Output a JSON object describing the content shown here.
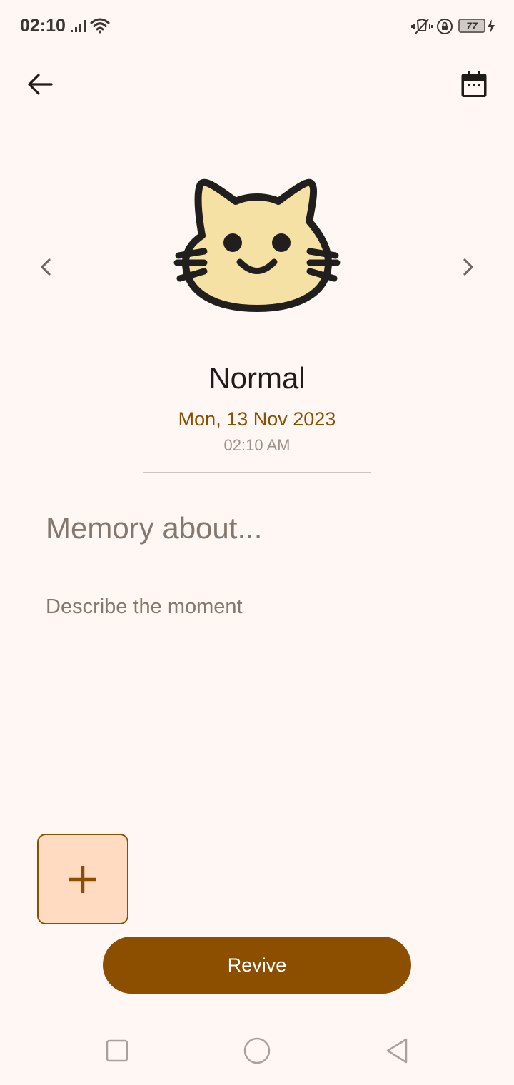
{
  "status_bar": {
    "time": "02:10",
    "battery_level": "77",
    "icons": [
      "signal-icon",
      "wifi-icon",
      "vibrate-icon",
      "lock-rotation-icon",
      "battery-icon",
      "charging-icon"
    ]
  },
  "toolbar": {
    "back_icon": "arrow-left-icon",
    "calendar_icon": "calendar-icon"
  },
  "mood": {
    "icon": "happy-cat-face-icon",
    "label": "Normal",
    "date": "Mon, 13 Nov 2023",
    "time": "02:10 AM",
    "prev_icon": "chevron-left-icon",
    "next_icon": "chevron-right-icon"
  },
  "memory": {
    "title_placeholder": "Memory about...",
    "title_value": "",
    "description_placeholder": "Describe the moment",
    "description_value": ""
  },
  "actions": {
    "add_icon": "plus-icon",
    "revive_label": "Revive"
  },
  "nav": {
    "recents_icon": "square-icon",
    "home_icon": "circle-icon",
    "back_icon": "triangle-back-icon"
  },
  "colors": {
    "background": "#fff7f3",
    "accent": "#8c4f00",
    "add_button_fill": "#ffdbc2",
    "cat_fill": "#f5e1a4",
    "secondary_text": "#84776f"
  }
}
